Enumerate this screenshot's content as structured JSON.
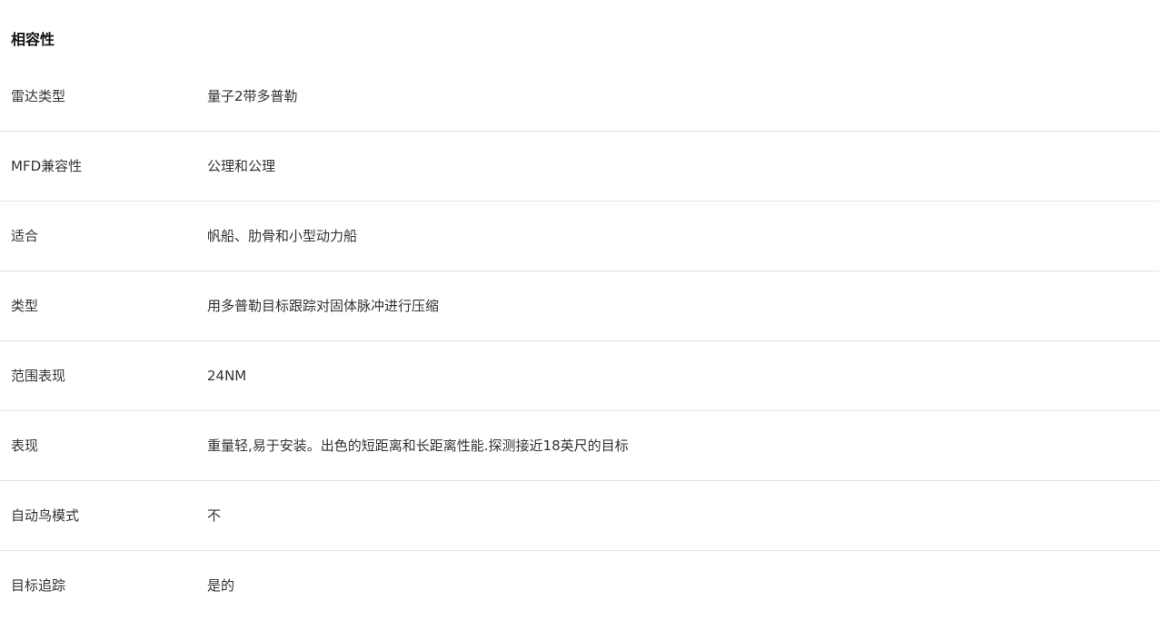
{
  "section": {
    "title": "相容性"
  },
  "specs": [
    {
      "label": "雷达类型",
      "value": "量子2带多普勒"
    },
    {
      "label": "MFD兼容性",
      "value": "公理和公理"
    },
    {
      "label": "适合",
      "value": "帆船、肋骨和小型动力船"
    },
    {
      "label": "类型",
      "value": "用多普勒目标跟踪对固体脉冲进行压缩"
    },
    {
      "label": "范围表现",
      "value": "24NM"
    },
    {
      "label": "表现",
      "value": "重量轻,易于安装。出色的短距离和长距离性能.探测接近18英尺的目标"
    },
    {
      "label": "自动鸟模式",
      "value": "不"
    },
    {
      "label": "目标追踪",
      "value": "是的"
    }
  ]
}
